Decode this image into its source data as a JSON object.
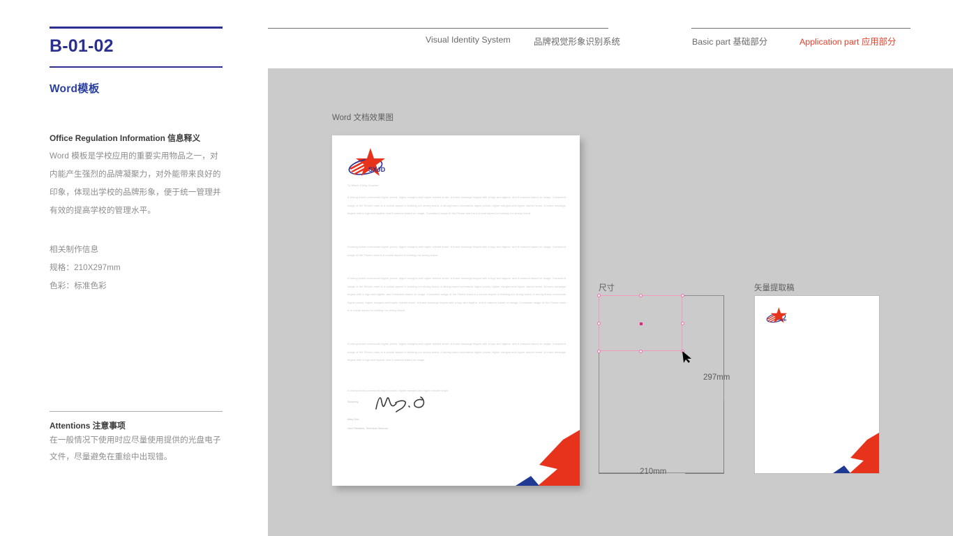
{
  "sidebar": {
    "code": "B-01-02",
    "subtitle": "Word模板",
    "info_heading": "Office Regulation Information  信息释义",
    "info_body": "Word 模板是学校应用的重要实用物品之一，对内能产生强烈的品牌凝聚力，对外能带来良好的印象，体现出学校的品牌形象，便于统一管理并有效的提高学校的管理水平。",
    "spec_lines": "相关制作信息\n规格：210X297mm\n色彩：标准色彩",
    "attention_heading": "Attentions 注意事项",
    "attention_body": "在一般情况下使用时应尽量使用提供的光盘电子文件，尽量避免在重绘中出现错。"
  },
  "header": {
    "vis_en": "Visual Identity System",
    "vis_cn": "品牌视觉形象识别系统",
    "basic_part": "Basic part  基础部分",
    "application_part": "Application part  应用部分"
  },
  "canvas": {
    "caption_word": "Word 文档效果图",
    "caption_size": "尺寸",
    "caption_vector": "矢量提取稿"
  },
  "letter": {
    "logo_text": "SXJD",
    "salutation": "To Whom It May Concern:",
    "paragraph_1": "A strong brand commands higher prices, higher margins,and higher market share. A brand message begins with a logo and tagline, and it matures based on usage. Consistent usage of the Plextor mark is a crucial aspect in building our strong brand. A strong brand commands higher prices, higher margins,and higher market share. A brand message begins with a logo and tagline, and it matures based on usage. Consistent usage of the Plextor mark is a crucial aspect in building our strong brand.",
    "paragraph_2": "A strong brand commands higher prices, higher margins,and higher market share. A brand message begins with a logo and tagline, and it matures based on usage. Consistent usage of the Plextor mark is a crucial aspect in building our strong brand.",
    "paragraph_3": "A strong brand commands higher prices, higher margins,and higher market share. A brand message begins with a logo and tagline, and it matures based on usage. Consistent usage of the Plextor mark is a crucial aspect in building our strong brand. A strong brand commands higher prices, higher margins,and higher market share. A brand message begins with a logo and tagline, and it matures based on usage. Consistent usage of the Plextor mark is a crucial aspect in building our strong brand. A strong brand commands higher prices, higher margins,and higher market share. A brand message begins with a logo and tagline, and it matures based on usage. Consistent usage of the Plextor mark is a crucial aspect in building our strong brand.",
    "paragraph_4": "A strong brand commands higher prices, higher margins,and higher market share. A brand message begins with a logo and tagline, and it matures based on usage. Consistent usage of the Plextor mark is a crucial aspect in building our strong brand. A strong brand commands higher prices, higher margins,and higher market share. A brand message begins with a logo and tagline, and it matures based on usage.",
    "paragraph_5": "A strong brand commands higher prices, higher margins,and higher market share.",
    "sincerely": "Sincerely,",
    "signature_glyph": "Mary. D",
    "signer_name": "Mary Doe",
    "signer_role": "Vice President, Technical Services"
  },
  "spec_panel": {
    "height_label": "297mm",
    "width_label": "210mm"
  },
  "colors": {
    "brand_blue": "#2b2f8f",
    "accent_red": "#e8402a",
    "logo_red": "#e8331c",
    "logo_blue": "#2b3190",
    "canvas_grey": "#cbcbcb",
    "selection_pink": "#ee74a8"
  }
}
